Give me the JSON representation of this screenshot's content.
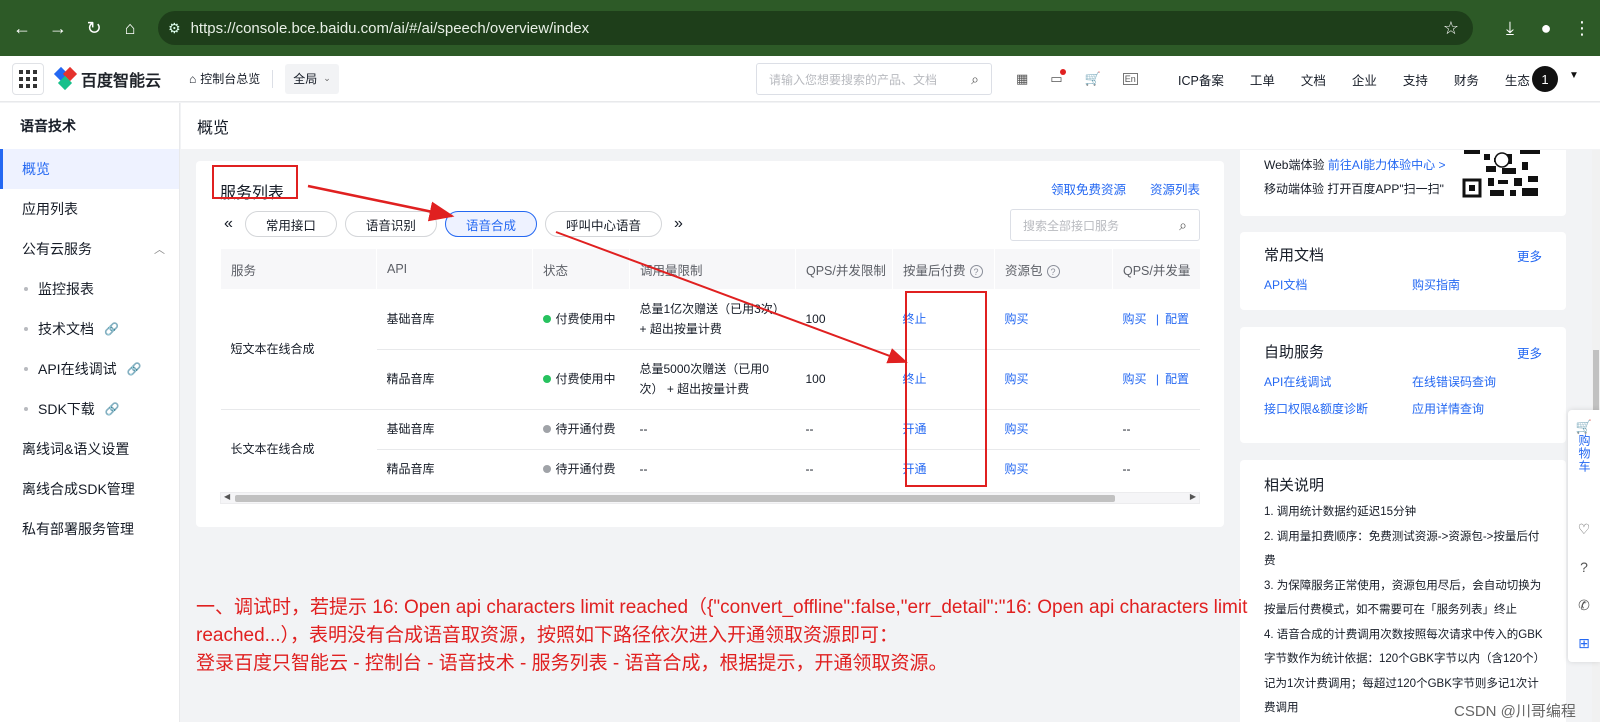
{
  "browser": {
    "url": "https://console.bce.baidu.com/ai/#/ai/speech/overview/index"
  },
  "topnav": {
    "logo": "百度智能云",
    "home": "控制台总览",
    "region": "全局",
    "search_placeholder": "请输入您想要搜索的产品、文档",
    "menu": [
      "ICP备案",
      "工单",
      "文档",
      "企业",
      "支持",
      "财务",
      "生态"
    ],
    "avatar": "1"
  },
  "sidebar": {
    "title": "语音技术",
    "items": [
      {
        "label": "概览",
        "active": true
      },
      {
        "label": "应用列表"
      }
    ],
    "group": "公有云服务",
    "subs": [
      "监控报表",
      "技术文档",
      "API在线调试",
      "SDK下载"
    ],
    "bottom": [
      "离线词&语义设置",
      "离线合成SDK管理",
      "私有部署服务管理"
    ]
  },
  "page": {
    "title": "概览"
  },
  "services": {
    "title": "服务列表",
    "links": [
      "领取免费资源",
      "资源列表"
    ],
    "tabs": [
      "常用接口",
      "语音识别",
      "语音合成",
      "呼叫中心语音"
    ],
    "search_placeholder": "搜索全部接口服务",
    "headers": [
      "服务",
      "API",
      "状态",
      "调用量限制",
      "QPS/并发限制",
      "按量后付费",
      "资源包",
      "QPS/并发量"
    ],
    "groups": [
      {
        "service": "短文本在线合成",
        "rows": [
          {
            "api": "基础音库",
            "status": "付费使用中",
            "limit": "总量1亿次赠送（已用3次）+ 超出按量计费",
            "qps": "100",
            "paid": "终止",
            "pack": "购买",
            "qps_buy": "购买",
            "qps_cfg": "配置"
          },
          {
            "api": "精品音库",
            "status": "付费使用中",
            "limit": "总量5000次赠送（已用0次） + 超出按量计费",
            "qps": "100",
            "paid": "终止",
            "pack": "购买",
            "qps_buy": "购买",
            "qps_cfg": "配置"
          }
        ]
      },
      {
        "service": "长文本在线合成",
        "rows": [
          {
            "api": "基础音库",
            "status": "待开通付费",
            "limit": "--",
            "qps": "--",
            "paid": "开通",
            "pack": "购买",
            "qps_buy": "--"
          },
          {
            "api": "精品音库",
            "status": "待开通付费",
            "limit": "--",
            "qps": "--",
            "paid": "开通",
            "pack": "购买",
            "qps_buy": "--"
          }
        ]
      }
    ]
  },
  "experience": {
    "web_label": "Web端体验",
    "web_link": "前往AI能力体验中心 >",
    "mobile_label": "移动端体验",
    "mobile_text": "打开百度APP\"扫一扫\""
  },
  "docs": {
    "title": "常用文档",
    "more": "更多",
    "links": [
      "API文档",
      "购买指南"
    ]
  },
  "self_service": {
    "title": "自助服务",
    "more": "更多",
    "links": [
      "API在线调试",
      "在线错误码查询",
      "接口权限&额度诊断",
      "应用详情查询"
    ]
  },
  "notes": {
    "title": "相关说明",
    "items": [
      "1. 调用统计数据约延迟15分钟",
      "2. 调用量扣费顺序：免费测试资源->资源包->按量后付费",
      "3. 为保障服务正常使用，资源包用尽后，会自动切换为按量后付费模式，如不需要可在「服务列表」终止",
      "4. 语音合成的计费调用次数按照每次请求中传入的GBK字节数作为统计依据：120个GBK字节以内（含120个）记为1次计费调用；每超过120个GBK字节则多记1次计费调用"
    ]
  },
  "float_bar": {
    "cart": "购物车"
  },
  "annotation": {
    "line1": "一、调试时，若提示 16: Open api characters limit reached（{\"convert_offline\":false,\"err_detail\":\"16: Open api characters limit reached...），表明没有合成语音取资源，按照如下路径依次进入开通领取资源即可：",
    "line2": "登录百度只智能云 - 控制台 - 语音技术 - 服务列表 - 语音合成，根据提示，开通领取资源。"
  },
  "watermark": "CSDN @川哥编程",
  "colors": {
    "accent": "#2468f2",
    "annotation_red": "#e02020",
    "browser_green": "#2d5a27",
    "paid_green": "#27c25f",
    "pending_gray": "#a0a3a8"
  }
}
